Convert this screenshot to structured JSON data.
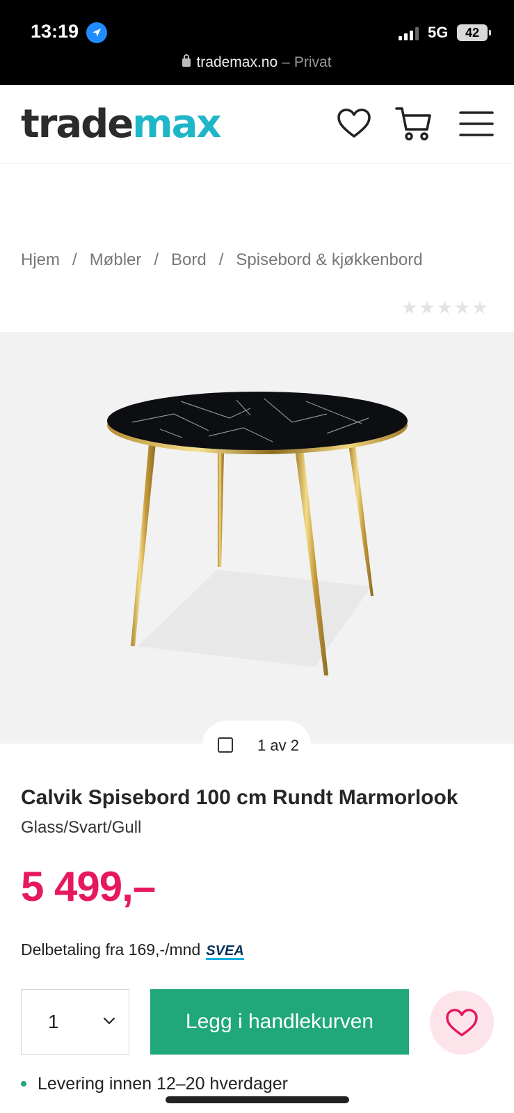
{
  "status_bar": {
    "time": "13:19",
    "network": "5G",
    "battery": "42",
    "icons": [
      "location-arrow-icon",
      "signal-icon",
      "battery-icon"
    ]
  },
  "browser": {
    "domain": "trademax.no",
    "separator": "–",
    "mode": "Privat"
  },
  "header": {
    "logo_part1": "trade",
    "logo_part2": "max",
    "icons": [
      "heart-icon",
      "cart-icon",
      "menu-icon"
    ],
    "logo_colors": {
      "dark": "#2b2b2b",
      "accent": "#1fb6c8"
    }
  },
  "breadcrumb": {
    "items": [
      "Hjem",
      "Møbler",
      "Bord",
      "Spisebord & kjøkkenbord"
    ],
    "separator": "/"
  },
  "rating": {
    "stars_filled": 0,
    "stars_total": 5
  },
  "gallery": {
    "counter": "1 av 2"
  },
  "product": {
    "title": "Calvik Spisebord 100 cm Rundt Marmorlook",
    "variant": "Glass/Svart/Gull",
    "price": "5 499,–",
    "price_color": "#e6195e",
    "installment": "Delbetaling fra 169,-/mnd",
    "installment_provider": "SVEA"
  },
  "purchase": {
    "quantity": "1",
    "add_to_cart_label": "Legg i handlekurven",
    "button_color": "#21a87a"
  },
  "delivery": {
    "text": "Levering innen 12–20 hverdager"
  }
}
